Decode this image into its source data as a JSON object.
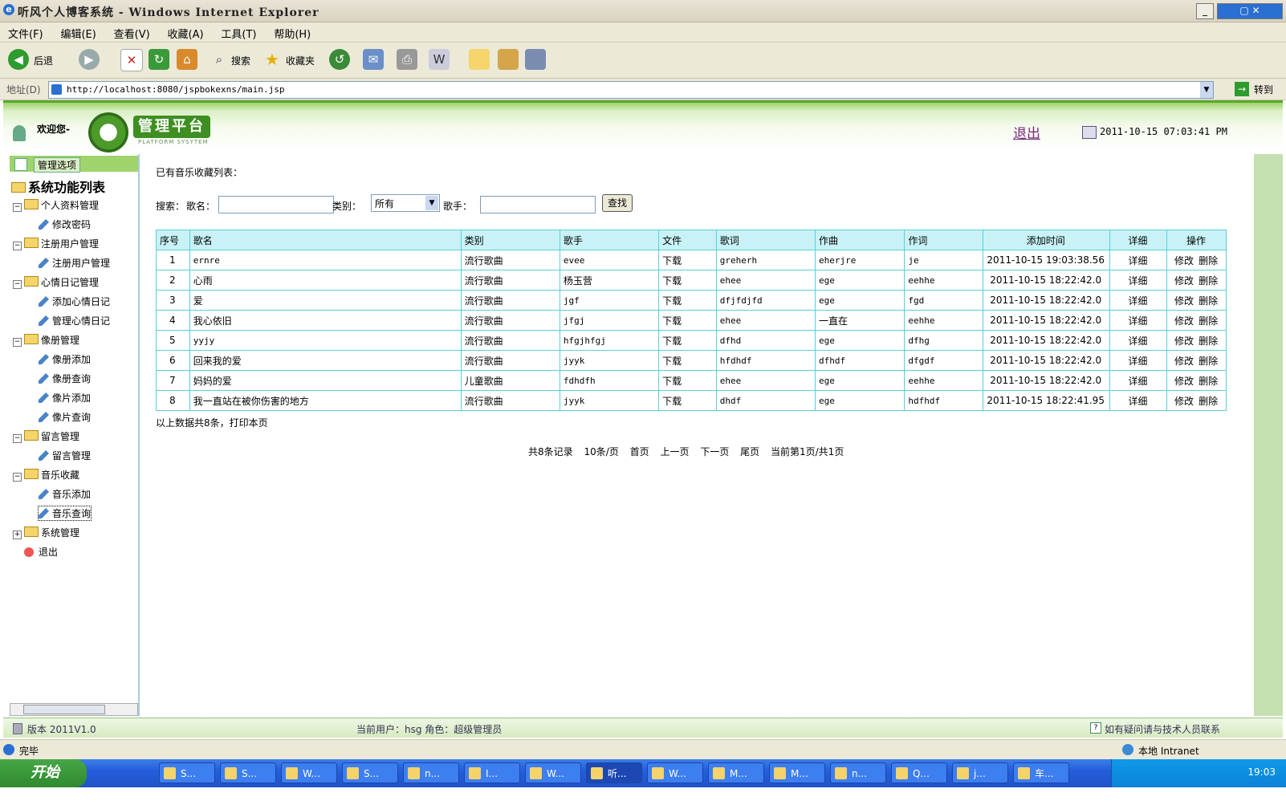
{
  "window": {
    "title": "听风个人博客系统 - Windows Internet Explorer"
  },
  "menu": [
    "文件(F)",
    "编辑(E)",
    "查看(V)",
    "收藏(A)",
    "工具(T)",
    "帮助(H)"
  ],
  "toolbar": {
    "back": "后退",
    "search": "搜索",
    "favorites": "收藏夹"
  },
  "address": {
    "label": "地址(D)",
    "url": "http://localhost:8080/jspbokexns/main.jsp",
    "go": "转到"
  },
  "banner": {
    "welcome": "欢迎您-",
    "platform": "管理平台",
    "platform_sub": "PLATFORM SYSYTEM",
    "logout": "退出",
    "datetime": "2011-10-15 07:03:41 PM"
  },
  "sidebar": {
    "header": "管理选项",
    "title": "系统功能列表",
    "items": [
      {
        "label": "个人资料管理",
        "type": "folder"
      },
      {
        "label": "修改密码",
        "type": "leaf"
      },
      {
        "label": "注册用户管理",
        "type": "folder"
      },
      {
        "label": "注册用户管理",
        "type": "leaf"
      },
      {
        "label": "心情日记管理",
        "type": "folder"
      },
      {
        "label": "添加心情日记",
        "type": "leaf"
      },
      {
        "label": "管理心情日记",
        "type": "leaf"
      },
      {
        "label": "像册管理",
        "type": "folder"
      },
      {
        "label": "像册添加",
        "type": "leaf"
      },
      {
        "label": "像册查询",
        "type": "leaf"
      },
      {
        "label": "像片添加",
        "type": "leaf"
      },
      {
        "label": "像片查询",
        "type": "leaf"
      },
      {
        "label": "留言管理",
        "type": "folder"
      },
      {
        "label": "留言管理",
        "type": "leaf"
      },
      {
        "label": "音乐收藏",
        "type": "folder"
      },
      {
        "label": "音乐添加",
        "type": "leaf"
      },
      {
        "label": "音乐查询",
        "type": "leaf"
      },
      {
        "label": "系统管理",
        "type": "folder-collapsed"
      },
      {
        "label": "退出",
        "type": "exit"
      }
    ]
  },
  "content": {
    "caption": "已有音乐收藏列表：",
    "search": {
      "label": "搜索：",
      "song_label": "歌名：",
      "category_label": "类别：",
      "category_value": "所有",
      "singer_label": "歌手：",
      "button": "查找"
    },
    "table": {
      "headers": [
        "序号",
        "歌名",
        "类别",
        "歌手",
        "文件",
        "歌词",
        "作曲",
        "作词",
        "添加时间",
        "详细",
        "操作"
      ],
      "rows": [
        [
          "1",
          "ernre",
          "流行歌曲",
          "evee",
          "下载",
          "greherh",
          "eherjre",
          "je",
          "2011-10-15 19:03:38.56",
          "详细"
        ],
        [
          "2",
          "心雨",
          "流行歌曲",
          "杨玉营",
          "下载",
          "ehee",
          "ege",
          "eehhe",
          "2011-10-15 18:22:42.0",
          "详细"
        ],
        [
          "3",
          "爱",
          "流行歌曲",
          "jgf",
          "下载",
          "dfjfdjfd",
          "ege",
          "fgd",
          "2011-10-15 18:22:42.0",
          "详细"
        ],
        [
          "4",
          "我心依旧",
          "流行歌曲",
          "jfgj",
          "下载",
          "ehee",
          "一直在",
          "eehhe",
          "2011-10-15 18:22:42.0",
          "详细"
        ],
        [
          "5",
          "yyjy",
          "流行歌曲",
          "hfgjhfgj",
          "下载",
          "dfhd",
          "ege",
          "dfhg",
          "2011-10-15 18:22:42.0",
          "详细"
        ],
        [
          "6",
          "回来我的爱",
          "流行歌曲",
          "jyyk",
          "下载",
          "hfdhdf",
          "dfhdf",
          "dfgdf",
          "2011-10-15 18:22:42.0",
          "详细"
        ],
        [
          "7",
          "妈妈的爱",
          "儿童歌曲",
          "fdhdfh",
          "下载",
          "ehee",
          "ege",
          "eehhe",
          "2011-10-15 18:22:42.0",
          "详细"
        ],
        [
          "8",
          "我一直站在被你伤害的地方",
          "流行歌曲",
          "jyyk",
          "下载",
          "dhdf",
          "ege",
          "hdfhdf",
          "2011-10-15 18:22:41.95",
          "详细"
        ]
      ],
      "edit_label": "修改",
      "delete_label": "删除"
    },
    "summary": "以上数据共8条，打印本页",
    "pager": {
      "total": "共8条记录",
      "per_page": "10条/页",
      "first": "首页",
      "prev": "上一页",
      "next": "下一页",
      "last": "尾页",
      "current": "当前第1页/共1页"
    }
  },
  "footer": {
    "version": "版本 2011V1.0",
    "user": "当前用户：hsg  角色：超级管理员",
    "help": "如有疑问请与技术人员联系"
  },
  "ie_status": {
    "left": "完毕",
    "zone": "本地 Intranet"
  },
  "taskbar": {
    "start": "开始",
    "tasks": [
      "S...",
      "S...",
      "W...",
      "S...",
      "n...",
      "I...",
      "W...",
      "听...",
      "W...",
      "M...",
      "M...",
      "n...",
      "Q...",
      "j...",
      "车..."
    ],
    "clock": "19:03"
  }
}
